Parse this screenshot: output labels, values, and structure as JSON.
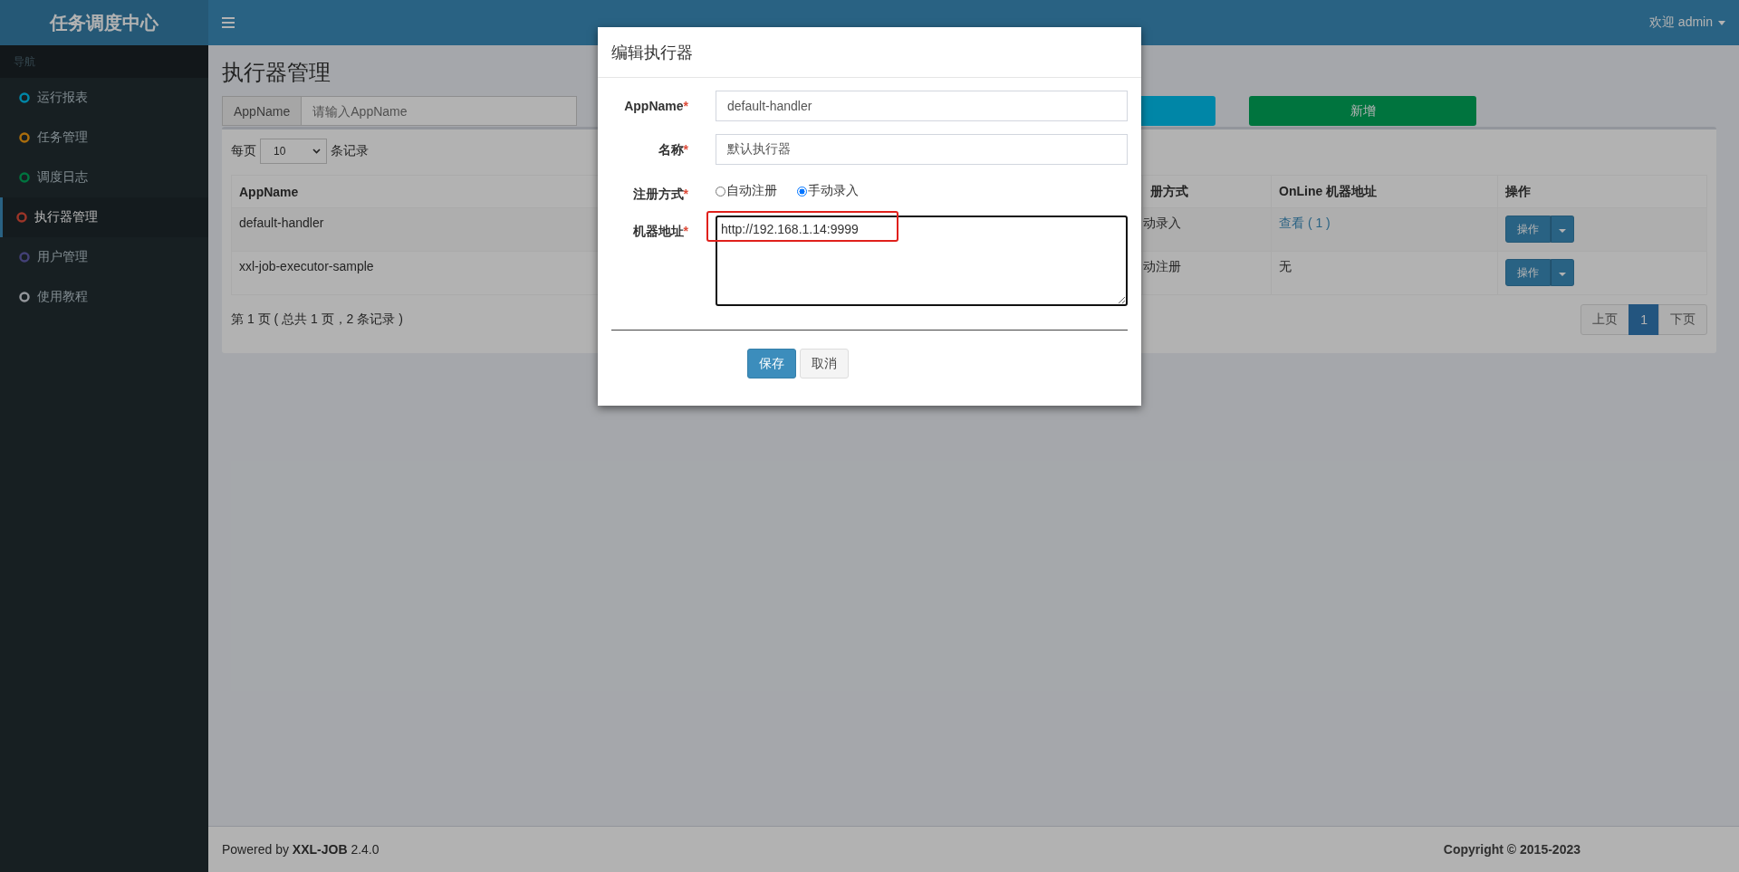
{
  "header": {
    "logo": "任务调度中心",
    "user": "欢迎 admin"
  },
  "sidebar": {
    "heading": "导航",
    "items": [
      {
        "label": "运行报表",
        "color": "#0086a7",
        "selected": false
      },
      {
        "label": "任务管理",
        "color": "#aa6d0d",
        "selected": false
      },
      {
        "label": "调度日志",
        "color": "#00743f",
        "selected": false
      },
      {
        "label": "执行器管理",
        "color": "#9b3528",
        "selected": true
      },
      {
        "label": "用户管理",
        "color": "#434076",
        "selected": false
      },
      {
        "label": "使用教程",
        "color": "#93969b",
        "selected": false
      }
    ]
  },
  "page": {
    "title": "执行器管理"
  },
  "search": {
    "label": "AppName",
    "placeholder": "请输入AppName"
  },
  "toolbar_buttons": [
    {
      "kind": "search"
    },
    {
      "kind": "add",
      "label": "新增"
    }
  ],
  "page_size": {
    "prefix": "每页",
    "value": "10",
    "suffix": "条记录"
  },
  "table": {
    "columns": [
      "AppName",
      "册方式",
      "OnLine 机器地址",
      "操作"
    ],
    "rows": [
      {
        "appname": "default-handler",
        "register": "动录入",
        "online": {
          "text": "查看 ( 1 )",
          "link": true
        },
        "action": "操作"
      },
      {
        "appname": "xxl-job-executor-sample",
        "register": "动注册",
        "online": {
          "text": "无",
          "link": false
        },
        "action": "操作"
      }
    ]
  },
  "pagination": {
    "summary": "第 1 页 ( 总共 1 页，2 条记录 )",
    "prev": "上页",
    "pages": [
      {
        "label": "1",
        "selected": true
      }
    ],
    "next": "下页"
  },
  "footer": {
    "powered": "Powered by **XXL-JOB** 2.4.0",
    "copyright": "Copyright © 2015-2023"
  },
  "modal": {
    "title": "编辑执行器",
    "fields": [
      {
        "kind": "text",
        "label": "AppName",
        "mark": "*",
        "value": "default-handler"
      },
      {
        "kind": "text",
        "label": "名称",
        "mark": "*",
        "value": "默认执行器"
      },
      {
        "kind": "radio",
        "label": "注册方式",
        "mark": "*",
        "options": [
          {
            "label": "自动注册",
            "selected": false
          },
          {
            "label": "手动录入",
            "selected": true
          }
        ]
      },
      {
        "kind": "textarea",
        "label": "机器地址",
        "mark": "*",
        "value": "http://192.168.1.14:9999",
        "highlighted": true
      }
    ],
    "buttons": [
      {
        "kind": "primary",
        "label": "保存"
      },
      {
        "kind": "default",
        "label": "取消"
      }
    ]
  }
}
